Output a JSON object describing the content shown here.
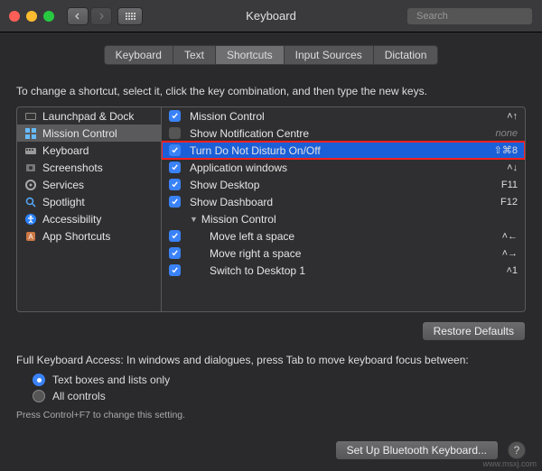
{
  "window": {
    "title": "Keyboard"
  },
  "search": {
    "placeholder": "Search"
  },
  "tabs": [
    {
      "label": "Keyboard",
      "active": false
    },
    {
      "label": "Text",
      "active": false
    },
    {
      "label": "Shortcuts",
      "active": true
    },
    {
      "label": "Input Sources",
      "active": false
    },
    {
      "label": "Dictation",
      "active": false
    }
  ],
  "hint": "To change a shortcut, select it, click the key combination, and then type the new keys.",
  "categories": [
    {
      "icon": "launchpad",
      "label": "Launchpad & Dock",
      "selected": false
    },
    {
      "icon": "mission",
      "label": "Mission Control",
      "selected": true
    },
    {
      "icon": "keyboard",
      "label": "Keyboard",
      "selected": false
    },
    {
      "icon": "screenshot",
      "label": "Screenshots",
      "selected": false
    },
    {
      "icon": "services",
      "label": "Services",
      "selected": false
    },
    {
      "icon": "spotlight",
      "label": "Spotlight",
      "selected": false
    },
    {
      "icon": "accessibility",
      "label": "Accessibility",
      "selected": false
    },
    {
      "icon": "app",
      "label": "App Shortcuts",
      "selected": false
    }
  ],
  "shortcuts": [
    {
      "checked": true,
      "label": "Mission Control",
      "key": "˄↑",
      "indent": false,
      "highlight": false
    },
    {
      "checked": false,
      "label": "Show Notification Centre",
      "key": "none",
      "indent": false,
      "highlight": false
    },
    {
      "checked": true,
      "label": "Turn Do Not Disturb On/Off",
      "key": "⇧⌘8",
      "indent": false,
      "highlight": true
    },
    {
      "checked": true,
      "label": "Application windows",
      "key": "˄↓",
      "indent": false,
      "highlight": false
    },
    {
      "checked": true,
      "label": "Show Desktop",
      "key": "F11",
      "indent": false,
      "highlight": false
    },
    {
      "checked": true,
      "label": "Show Dashboard",
      "key": "F12",
      "indent": false,
      "highlight": false
    },
    {
      "checked": null,
      "label": "Mission Control",
      "key": "",
      "indent": false,
      "group": true,
      "highlight": false
    },
    {
      "checked": true,
      "label": "Move left a space",
      "key": "˄←",
      "indent": true,
      "highlight": false
    },
    {
      "checked": true,
      "label": "Move right a space",
      "key": "˄→",
      "indent": true,
      "highlight": false
    },
    {
      "checked": true,
      "label": "Switch to Desktop 1",
      "key": "˄1",
      "indent": true,
      "highlight": false
    }
  ],
  "restore_btn": "Restore Defaults",
  "fka": {
    "desc": "Full Keyboard Access: In windows and dialogues, press Tab to move keyboard focus between:",
    "opt1": "Text boxes and lists only",
    "opt2": "All controls",
    "tip": "Press Control+F7 to change this setting."
  },
  "footer": {
    "bt_btn": "Set Up Bluetooth Keyboard...",
    "help": "?"
  },
  "watermark": "www.msxj.com"
}
